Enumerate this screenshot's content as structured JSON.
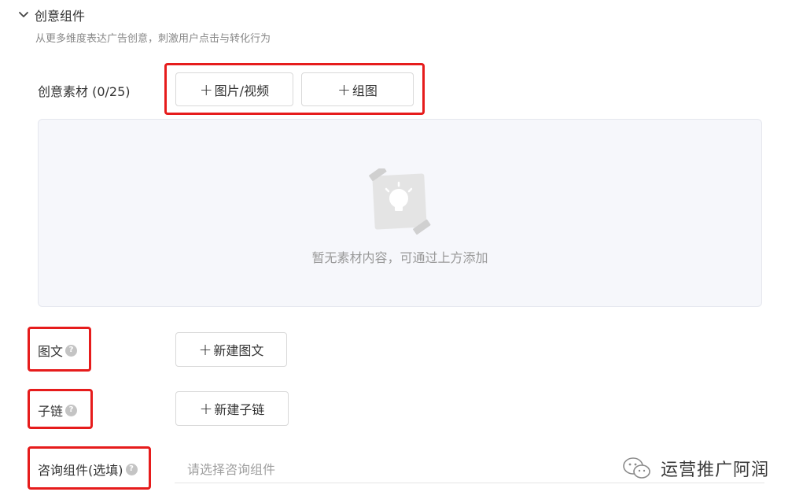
{
  "section": {
    "title": "创意组件",
    "description": "从更多维度表达广告创意，刺激用户点击与转化行为"
  },
  "creative_material": {
    "label": "创意素材 (0/25)",
    "add_media_label": "图片/视频",
    "add_group_label": "组图",
    "empty_text": "暂无素材内容，可通过上方添加"
  },
  "image_text": {
    "label": "图文",
    "button_label": "新建图文"
  },
  "sublink": {
    "label": "子链",
    "button_label": "新建子链"
  },
  "consult": {
    "label": "咨询组件(选填)",
    "placeholder": "请选择咨询组件"
  },
  "watermark": {
    "text": "运营推广阿润"
  },
  "icons": {
    "plus": "+",
    "help": "?"
  },
  "colors": {
    "highlight_box": "#e61c1c",
    "empty_bg": "#f6f7fb"
  }
}
